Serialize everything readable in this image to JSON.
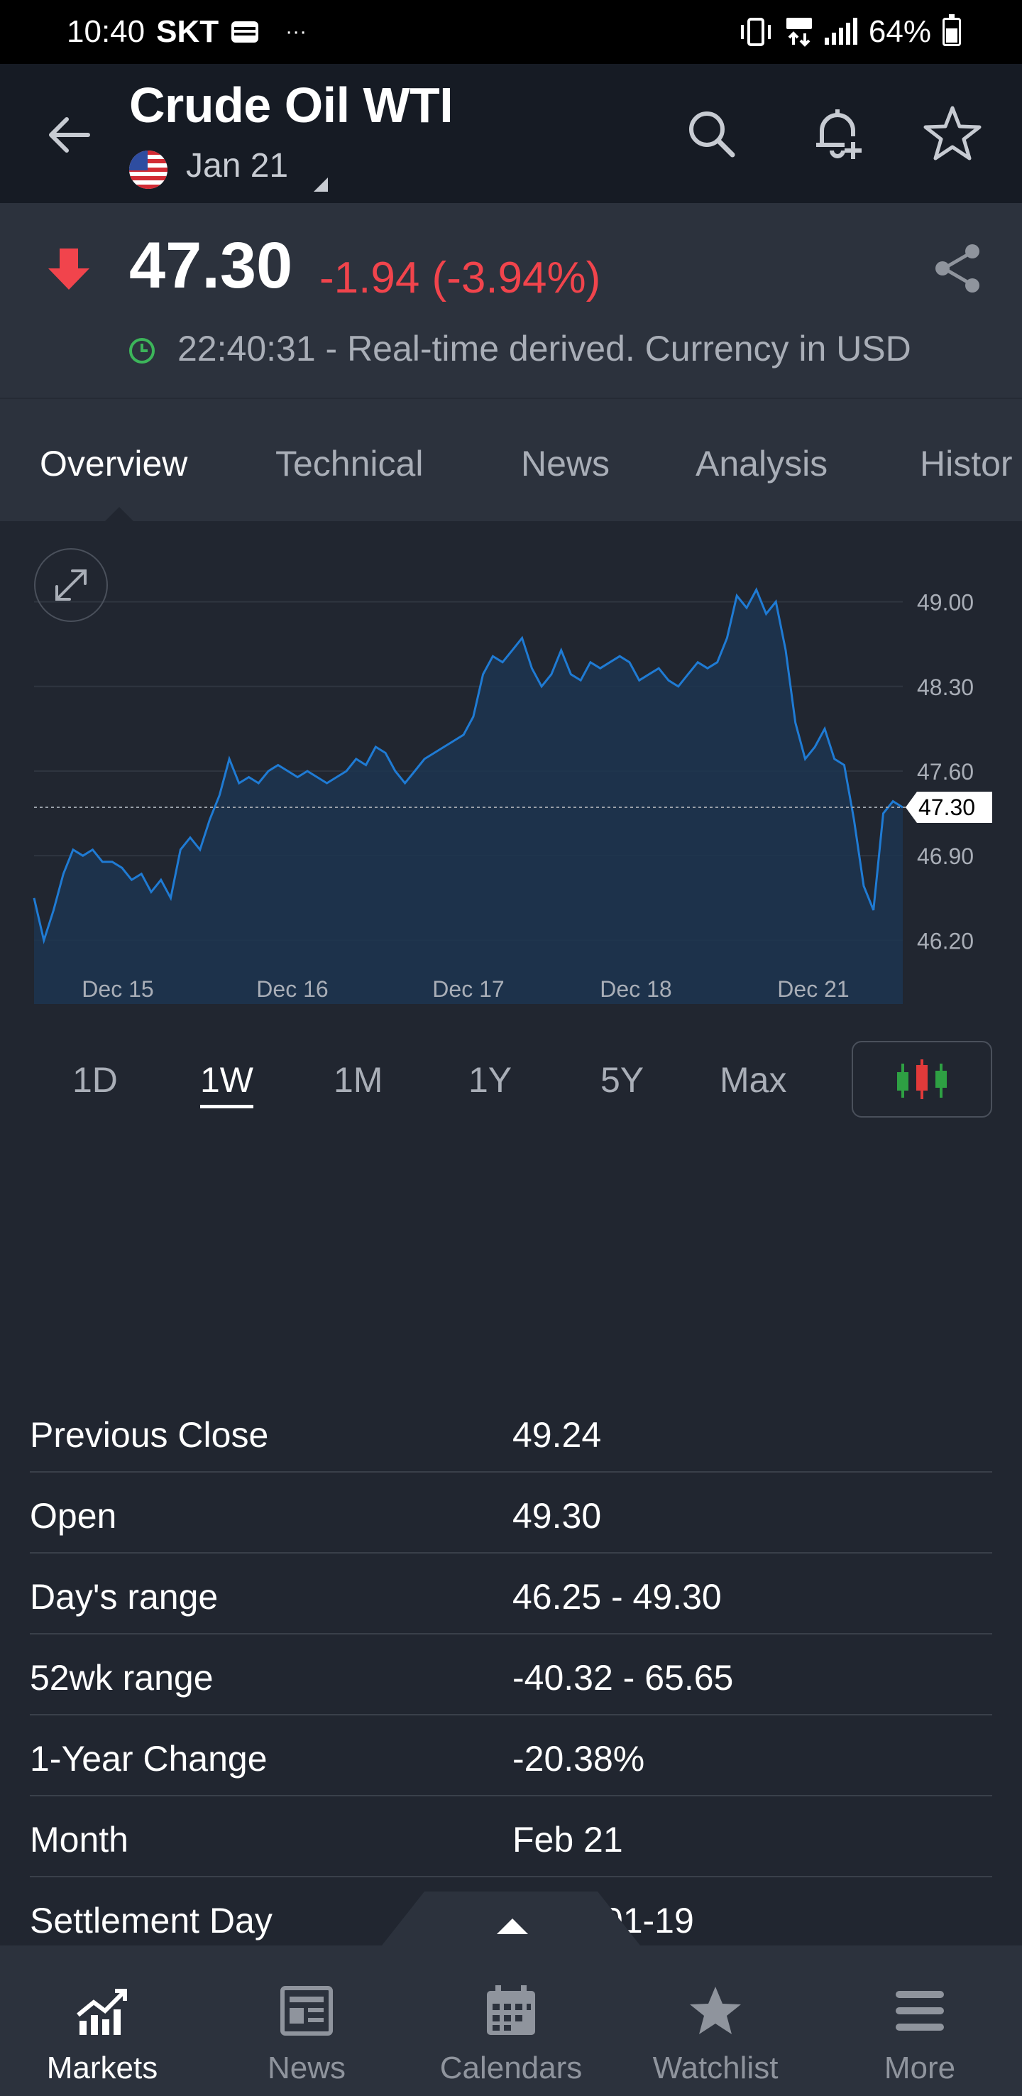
{
  "status_bar": {
    "time": "10:40",
    "carrier": "SKT",
    "dots": "···",
    "battery": "64%"
  },
  "header": {
    "title": "Crude Oil WTI",
    "contract_month": "Jan 21"
  },
  "quote": {
    "price": "47.30",
    "change": "-1.94 (-3.94%)",
    "time_note": "22:40:31 - Real-time derived. Currency in USD",
    "down_color": "#f1444c"
  },
  "tabs": [
    {
      "label": "Overview",
      "active": true
    },
    {
      "label": "Technical"
    },
    {
      "label": "News"
    },
    {
      "label": "Analysis"
    },
    {
      "label": "Histor"
    }
  ],
  "chart_data": {
    "type": "area",
    "x_tick_labels": [
      "Dec 15",
      "Dec 16",
      "Dec 17",
      "Dec 18",
      "Dec 21"
    ],
    "y_tick_labels": [
      "49.00",
      "48.30",
      "47.60",
      "46.90",
      "46.20"
    ],
    "ylim": [
      45.85,
      49.15
    ],
    "current_value": 47.3,
    "current_label": "47.30",
    "line_color": "#1f7bd4",
    "series": [
      {
        "values": [
          46.55,
          46.2,
          46.45,
          46.75,
          46.95,
          46.9,
          46.95,
          46.85,
          46.85,
          46.8,
          46.7,
          46.75,
          46.6,
          46.7,
          46.55,
          46.95,
          47.05,
          46.95,
          47.2,
          47.4,
          47.7,
          47.5,
          47.55,
          47.5,
          47.6,
          47.65,
          47.6,
          47.55,
          47.6,
          47.55,
          47.5,
          47.55,
          47.6,
          47.7,
          47.65,
          47.8,
          47.75,
          47.6,
          47.5,
          47.6,
          47.7,
          47.75,
          47.8,
          47.85,
          47.9,
          48.05,
          48.4,
          48.55,
          48.5,
          48.6,
          48.7,
          48.45,
          48.3,
          48.4,
          48.6,
          48.4,
          48.35,
          48.5,
          48.45,
          48.5,
          48.55,
          48.5,
          48.35,
          48.4,
          48.45,
          48.35,
          48.3,
          48.4,
          48.5,
          48.45,
          48.5,
          48.7,
          49.05,
          48.95,
          49.1,
          48.9,
          49.0,
          48.6,
          48.0,
          47.7,
          47.8,
          47.95,
          47.7,
          47.65,
          47.2,
          46.65,
          46.45,
          47.25,
          47.35,
          47.3
        ]
      }
    ]
  },
  "ranges": [
    {
      "label": "1D"
    },
    {
      "label": "1W",
      "active": true
    },
    {
      "label": "1M"
    },
    {
      "label": "1Y"
    },
    {
      "label": "5Y"
    },
    {
      "label": "Max"
    }
  ],
  "stats": [
    {
      "label": "Previous Close",
      "value": "49.24"
    },
    {
      "label": "Open",
      "value": "49.30"
    },
    {
      "label": "Day's range",
      "value": "46.25 - 49.30"
    },
    {
      "label": "52wk range",
      "value": "-40.32 - 65.65"
    },
    {
      "label": "1-Year Change",
      "value": "-20.38%"
    },
    {
      "label": "Month",
      "value": "Feb 21"
    },
    {
      "label": "Settlement Day",
      "value": "2021-01-19"
    }
  ],
  "bottom_nav": [
    {
      "label": "Markets",
      "icon": "markets-icon",
      "active": true
    },
    {
      "label": "News",
      "icon": "news-icon"
    },
    {
      "label": "Calendars",
      "icon": "calendar-icon"
    },
    {
      "label": "Watchlist",
      "icon": "star-icon"
    },
    {
      "label": "More",
      "icon": "menu-icon"
    }
  ]
}
